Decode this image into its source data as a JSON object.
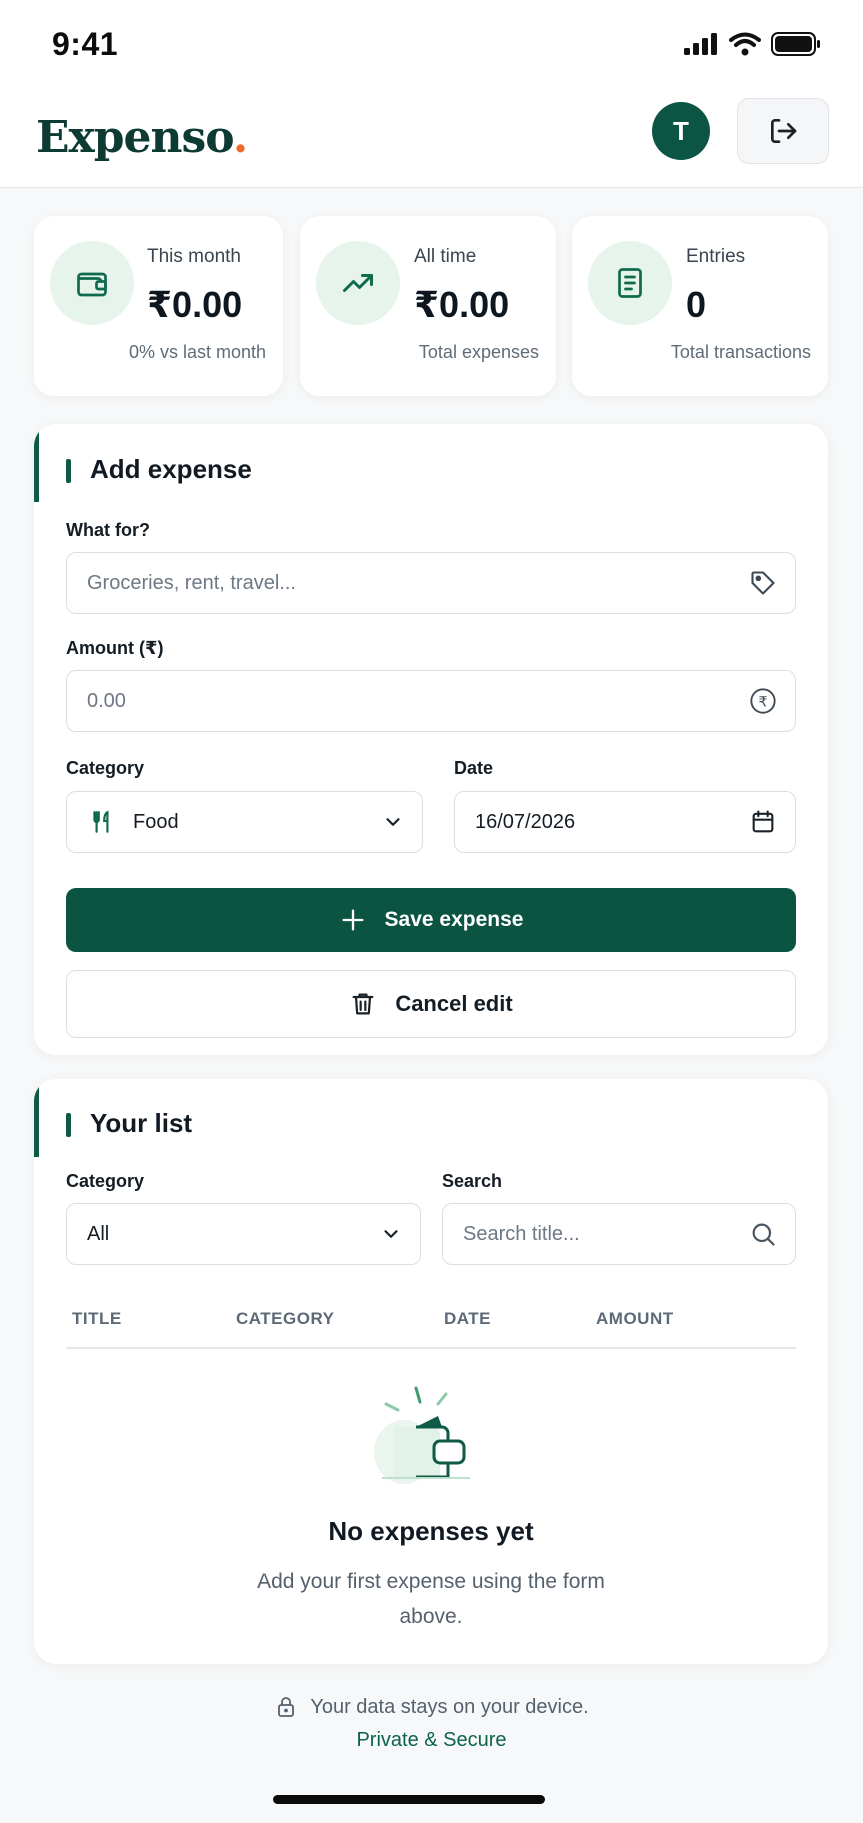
{
  "status_bar": {
    "time": "9:41"
  },
  "header": {
    "logo_text": "Expenso",
    "logo_dot": ".",
    "avatar_initial": "T"
  },
  "stats": [
    {
      "label": "This month",
      "value": "₹0.00",
      "sub": "0% vs last month",
      "icon": "wallet-icon"
    },
    {
      "label": "All time",
      "value": "₹0.00",
      "sub": "Total expenses",
      "icon": "trending-up-icon"
    },
    {
      "label": "Entries",
      "value": "0",
      "sub": "Total transactions",
      "icon": "receipt-icon"
    }
  ],
  "add_form": {
    "title": "Add expense",
    "what_label": "What for?",
    "what_placeholder": "Groceries, rent, travel...",
    "amount_label": "Amount (₹)",
    "amount_placeholder": "0.00",
    "category_label": "Category",
    "category_value": "Food",
    "date_label": "Date",
    "date_value": "16/07/2026",
    "save_label": "Save expense",
    "cancel_label": "Cancel edit"
  },
  "list": {
    "title": "Your list",
    "filter_label": "Category",
    "filter_value": "All",
    "search_label": "Search",
    "search_placeholder": "Search title...",
    "columns": [
      "TITLE",
      "CATEGORY",
      "DATE",
      "AMOUNT"
    ],
    "empty_title": "No expenses yet",
    "empty_text": "Add your first expense using the form above."
  },
  "footer": {
    "note": "Your data stays on your device.",
    "link": "Private & Secure"
  },
  "colors": {
    "brand": "#0b5442",
    "accent": "#ef6a2a",
    "icon_bg": "#e7f4ec"
  }
}
